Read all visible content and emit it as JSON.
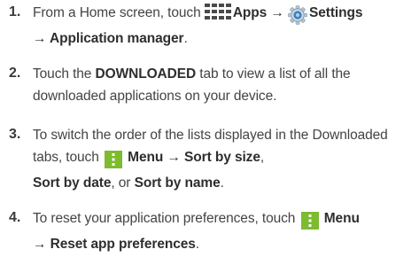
{
  "steps": [
    {
      "number": "1.",
      "parts": {
        "a": "From a Home screen, touch",
        "apps": "Apps →",
        "settings": "Settings",
        "appmgr": "→ Application manager",
        "end": "."
      }
    },
    {
      "number": "2.",
      "parts": {
        "a": "Touch the",
        "downloaded": "DOWNLOADED",
        "b": "tab to view a list of all the downloaded applications on your device."
      }
    },
    {
      "number": "3.",
      "parts": {
        "a": "To switch the order of the lists displayed in the Downloaded tabs, touch",
        "menu_sort": "Menu → Sort by size",
        "comma": ",",
        "date": "Sort by date",
        "or": ", or",
        "name": "Sort by name",
        "end": "."
      }
    },
    {
      "number": "4.",
      "parts": {
        "a": "To reset your application preferences, touch",
        "menu": "Menu",
        "reset": "→ Reset app preferences",
        "end": "."
      }
    }
  ],
  "colors": {
    "apps_icon": "#4a4a4a",
    "settings_icon_blue": "#3a7fc1",
    "menu_icon_bg": "#7dbb2f",
    "menu_icon_dots": "#ffffff",
    "text": "#444444",
    "bold_text": "#2e2e2e"
  },
  "icons": [
    "apps-grid-icon",
    "settings-gear-icon",
    "menu-dots-icon"
  ]
}
